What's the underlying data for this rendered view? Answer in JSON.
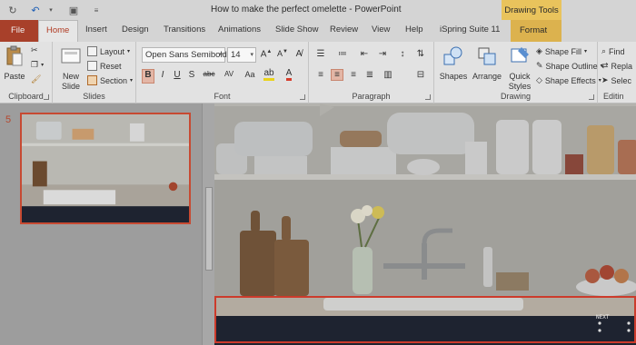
{
  "window": {
    "title": "How to make the perfect omelette  -  PowerPoint"
  },
  "contextual": {
    "group": "Drawing Tools",
    "tab": "Format"
  },
  "tabs": [
    "Home",
    "Insert",
    "Design",
    "Transitions",
    "Animations",
    "Slide Show",
    "Review",
    "View",
    "Help",
    "iSpring Suite 11"
  ],
  "file_tab": "File",
  "ribbon": {
    "clipboard": {
      "label": "Clipboard",
      "paste": "Paste"
    },
    "slides": {
      "label": "Slides",
      "new_slide": "New Slide",
      "layout": "Layout",
      "reset": "Reset",
      "section": "Section"
    },
    "font": {
      "label": "Font",
      "font_name": "Open Sans Semibold",
      "font_size": "14",
      "bold": "B",
      "italic": "I",
      "underline": "U",
      "shadow": "S",
      "strike": "abc",
      "spacing": "AV",
      "case": "Aa"
    },
    "paragraph": {
      "label": "Paragraph"
    },
    "drawing": {
      "label": "Drawing",
      "shapes": "Shapes",
      "arrange": "Arrange",
      "quick_styles": "Quick Styles",
      "shape_fill": "Shape Fill",
      "shape_outline": "Shape Outline",
      "shape_effects": "Shape Effects"
    },
    "editing": {
      "label": "Editin",
      "find": "Find",
      "replace": "Repla",
      "select": "Selec"
    }
  },
  "slide_panel": {
    "current_slide_number": "5"
  },
  "slide": {
    "caption_text": "NEXT"
  },
  "colors": {
    "file_tab": "#a8402a",
    "contextual": "#e9c35c",
    "selection": "#cc3b2c",
    "caption_bar": "#1e2330"
  }
}
